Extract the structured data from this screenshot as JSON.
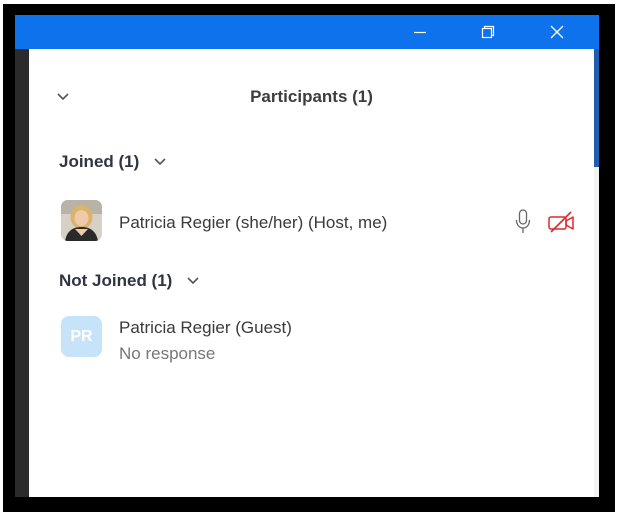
{
  "colors": {
    "titlebar": "#0e72ed",
    "window_bg": "#ffffff",
    "muted_video": "#e02828",
    "initials_avatar_bg": "#c6e3f9"
  },
  "window": {
    "controls": [
      {
        "name": "minimize",
        "icon": "minimize-icon"
      },
      {
        "name": "restore",
        "icon": "restore-icon"
      },
      {
        "name": "close",
        "icon": "close-icon"
      }
    ]
  },
  "panel": {
    "title": "Participants (1)",
    "collapse_icon": "chevron-down-icon"
  },
  "sections": {
    "joined": {
      "label": "Joined (1)",
      "participants": [
        {
          "name": "Patricia Regier (she/her)",
          "tags": "(Host, me)",
          "avatar": "photo",
          "mic_icon": "microphone-icon",
          "video_icon": "video-off-icon"
        }
      ]
    },
    "not_joined": {
      "label": "Not Joined (1)",
      "participants": [
        {
          "name": "Patricia Regier",
          "tags": "(Guest)",
          "initials": "PR",
          "status": "No response"
        }
      ]
    }
  }
}
